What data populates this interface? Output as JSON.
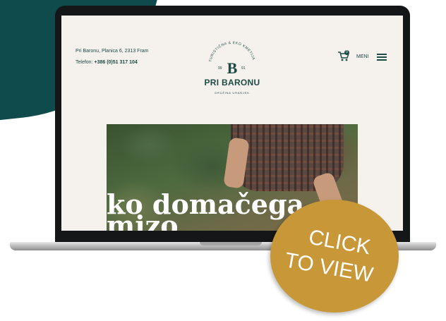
{
  "site": {
    "address": "Pri Baronu, Planica 6, 2313 Fram",
    "phone_label": "Telefon:",
    "phone_number": "+386 (0)51 317 104",
    "logo": {
      "arc_text": "TURISTIČNA & EKO KMETIJA",
      "letter": "B",
      "num_left": "99",
      "num_right": "91",
      "name": "PRI BARONU",
      "subtitle": "DRUŽINA URANJEK"
    },
    "cart_count": "0",
    "menu_label": "MENI",
    "hero_line1": "ko domačega",
    "hero_line2": "mizo"
  },
  "cta": {
    "line1": "CLICK",
    "line2": "TO VIEW"
  },
  "colors": {
    "brand_dark": "#1d4a44",
    "accent_gold": "#c89737",
    "teal_blob": "#0f4b4d",
    "page_bg": "#f5f1ec"
  },
  "icons": [
    "cart-icon",
    "hamburger-menu-icon"
  ]
}
